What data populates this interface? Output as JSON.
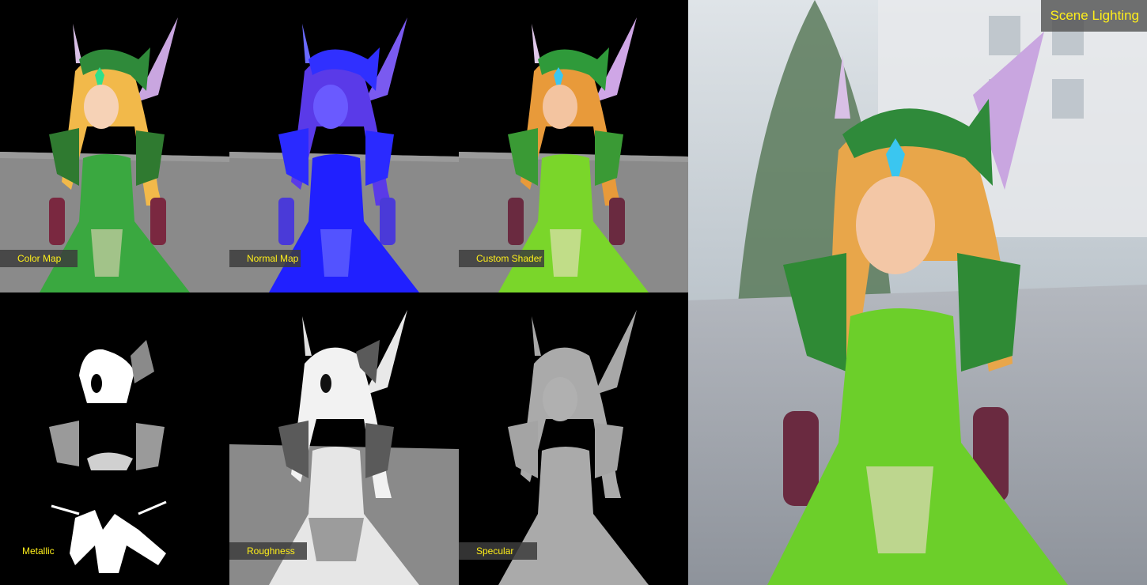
{
  "maps": [
    {
      "id": "color",
      "label": "Color Map",
      "icon": "character-render-color"
    },
    {
      "id": "normal",
      "label": "Normal Map",
      "icon": "character-render-normal"
    },
    {
      "id": "custom",
      "label": "Custom Shader",
      "icon": "character-render-custom"
    },
    {
      "id": "metallic",
      "label": "Metallic",
      "icon": "character-render-metallic"
    },
    {
      "id": "roughness",
      "label": "Roughness",
      "icon": "character-render-roughness"
    },
    {
      "id": "specular",
      "label": "Specular",
      "icon": "character-render-specular"
    }
  ],
  "scene": {
    "label": "Scene Lighting"
  },
  "colors": {
    "label_text": "#ffef1a",
    "label_bg": "#3c3c3c",
    "floor_gray": "#7a7a7a"
  }
}
